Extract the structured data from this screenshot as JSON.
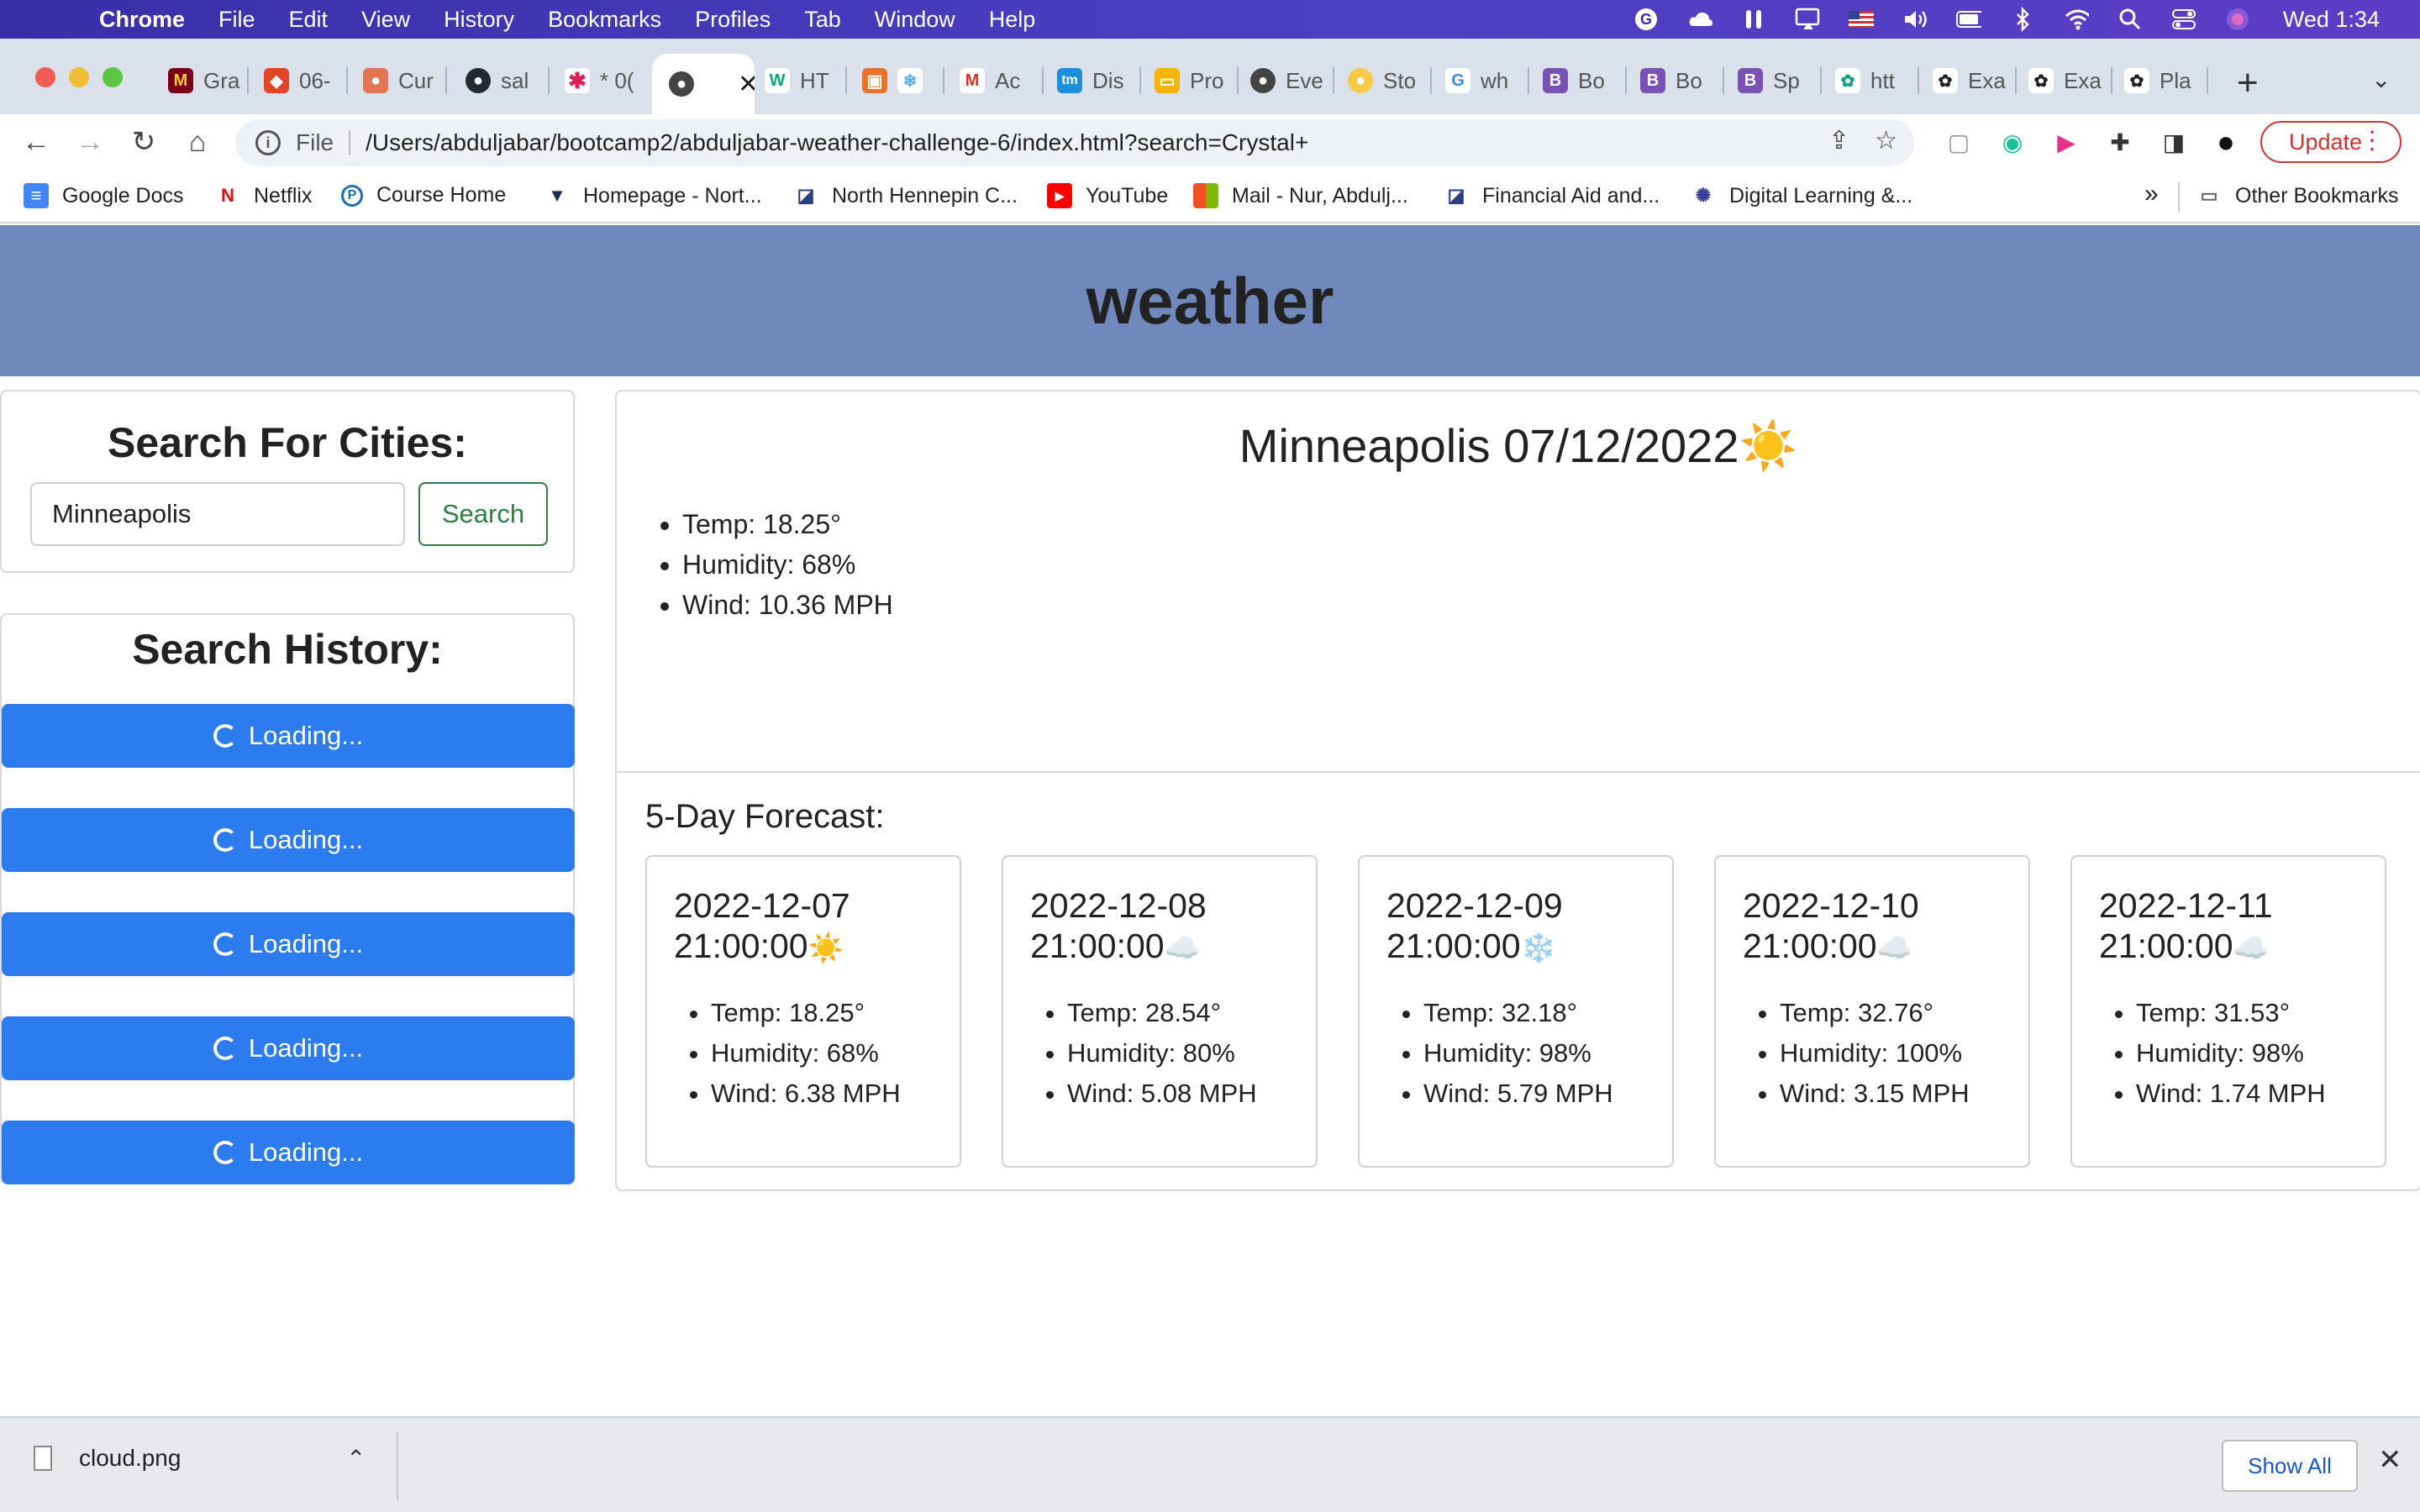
{
  "menubar": {
    "app_name": "Chrome",
    "items": [
      "File",
      "Edit",
      "View",
      "History",
      "Bookmarks",
      "Profiles",
      "Tab",
      "Window",
      "Help"
    ],
    "clock": "Wed 1:34",
    "status_icons": [
      "grammarly-icon",
      "cloud-icon",
      "airpods-icon",
      "screen-mirror-icon",
      "us-flag-icon",
      "volume-icon",
      "battery-icon",
      "bluetooth-icon",
      "wifi-icon",
      "spotlight-search-icon",
      "control-center-icon",
      "siri-icon"
    ]
  },
  "tabs": [
    {
      "label": "Gra",
      "icon": "minnesota-icon"
    },
    {
      "label": "06-",
      "icon": "gitlab-icon"
    },
    {
      "label": "Cur",
      "icon": "canvas-icon"
    },
    {
      "label": "sal",
      "icon": "github-icon"
    },
    {
      "label": "* 0(",
      "icon": "slack-icon"
    },
    {
      "label": "",
      "icon": "globe-icon",
      "active": true
    },
    {
      "label": "HT",
      "icon": "w3schools-icon"
    },
    {
      "label": "",
      "icon": "snowflake-icon"
    },
    {
      "label": "Ac",
      "icon": "gmail-icon"
    },
    {
      "label": "Dis",
      "icon": "tm-icon"
    },
    {
      "label": "Pro",
      "icon": "slides-icon"
    },
    {
      "label": "Eve",
      "icon": "globe-icon"
    },
    {
      "label": "Sto",
      "icon": "bootcamp-icon"
    },
    {
      "label": "wh",
      "icon": "google-icon"
    },
    {
      "label": "Bo",
      "icon": "bootstrap-icon"
    },
    {
      "label": "Bo",
      "icon": "bootstrap-icon"
    },
    {
      "label": "Sp",
      "icon": "bootstrap-icon"
    },
    {
      "label": "htt",
      "icon": "chatgpt-icon"
    },
    {
      "label": "Exa",
      "icon": "openai-icon"
    },
    {
      "label": "Exa",
      "icon": "openai-icon"
    },
    {
      "label": "Pla",
      "icon": "openai-icon"
    }
  ],
  "omnibox": {
    "protocol_label": "File",
    "url": "/Users/abduljabar/bootcamp2/abduljabar-weather-challenge-6/index.html?search=Crystal+"
  },
  "update_label": "Update",
  "bookmarks": [
    {
      "label": "Google Docs",
      "icon": "google-docs-icon"
    },
    {
      "label": "Netflix",
      "icon": "netflix-icon"
    },
    {
      "label": "Course Home",
      "icon": "course-home-icon"
    },
    {
      "label": "Homepage - Nort...",
      "icon": "bookmark-icon"
    },
    {
      "label": "North Hennepin C...",
      "icon": "nhcc-icon"
    },
    {
      "label": "YouTube",
      "icon": "youtube-icon"
    },
    {
      "label": "Mail - Nur, Abdulj...",
      "icon": "microsoft-icon"
    },
    {
      "label": "Financial Aid and...",
      "icon": "nhcc-icon"
    },
    {
      "label": "Digital Learning &...",
      "icon": "digital-learning-icon"
    }
  ],
  "other_bookmarks": "Other Bookmarks",
  "page": {
    "title": "weather",
    "search": {
      "heading": "Search For Cities:",
      "input_value": "Minneapolis",
      "button_label": "Search"
    },
    "history": {
      "heading": "Search History:",
      "items": [
        "Loading...",
        "Loading...",
        "Loading...",
        "Loading...",
        "Loading..."
      ]
    },
    "current": {
      "title": "Minneapolis 07/12/2022",
      "emoji": "☀️",
      "stats": [
        "Temp: 18.25°",
        "Humidity: 68%",
        "Wind: 10.36 MPH"
      ]
    },
    "forecast": {
      "heading": "5-Day Forecast:",
      "days": [
        {
          "date": "2022-12-07",
          "time": "21:00:00",
          "emoji": "☀️",
          "temp": "Temp: 18.25°",
          "humidity": "Humidity: 68%",
          "wind": "Wind: 6.38 MPH"
        },
        {
          "date": "2022-12-08",
          "time": "21:00:00",
          "emoji": "☁️",
          "temp": "Temp: 28.54°",
          "humidity": "Humidity: 80%",
          "wind": "Wind: 5.08 MPH"
        },
        {
          "date": "2022-12-09",
          "time": "21:00:00",
          "emoji": "❄️",
          "temp": "Temp: 32.18°",
          "humidity": "Humidity: 98%",
          "wind": "Wind: 5.79 MPH"
        },
        {
          "date": "2022-12-10",
          "time": "21:00:00",
          "emoji": "☁️",
          "temp": "Temp: 32.76°",
          "humidity": "Humidity: 100%",
          "wind": "Wind: 3.15 MPH"
        },
        {
          "date": "2022-12-11",
          "time": "21:00:00",
          "emoji": "☁️",
          "temp": "Temp: 31.53°",
          "humidity": "Humidity: 98%",
          "wind": "Wind: 1.74 MPH"
        }
      ]
    }
  },
  "downloads": {
    "file_name": "cloud.png",
    "show_all_label": "Show All"
  }
}
